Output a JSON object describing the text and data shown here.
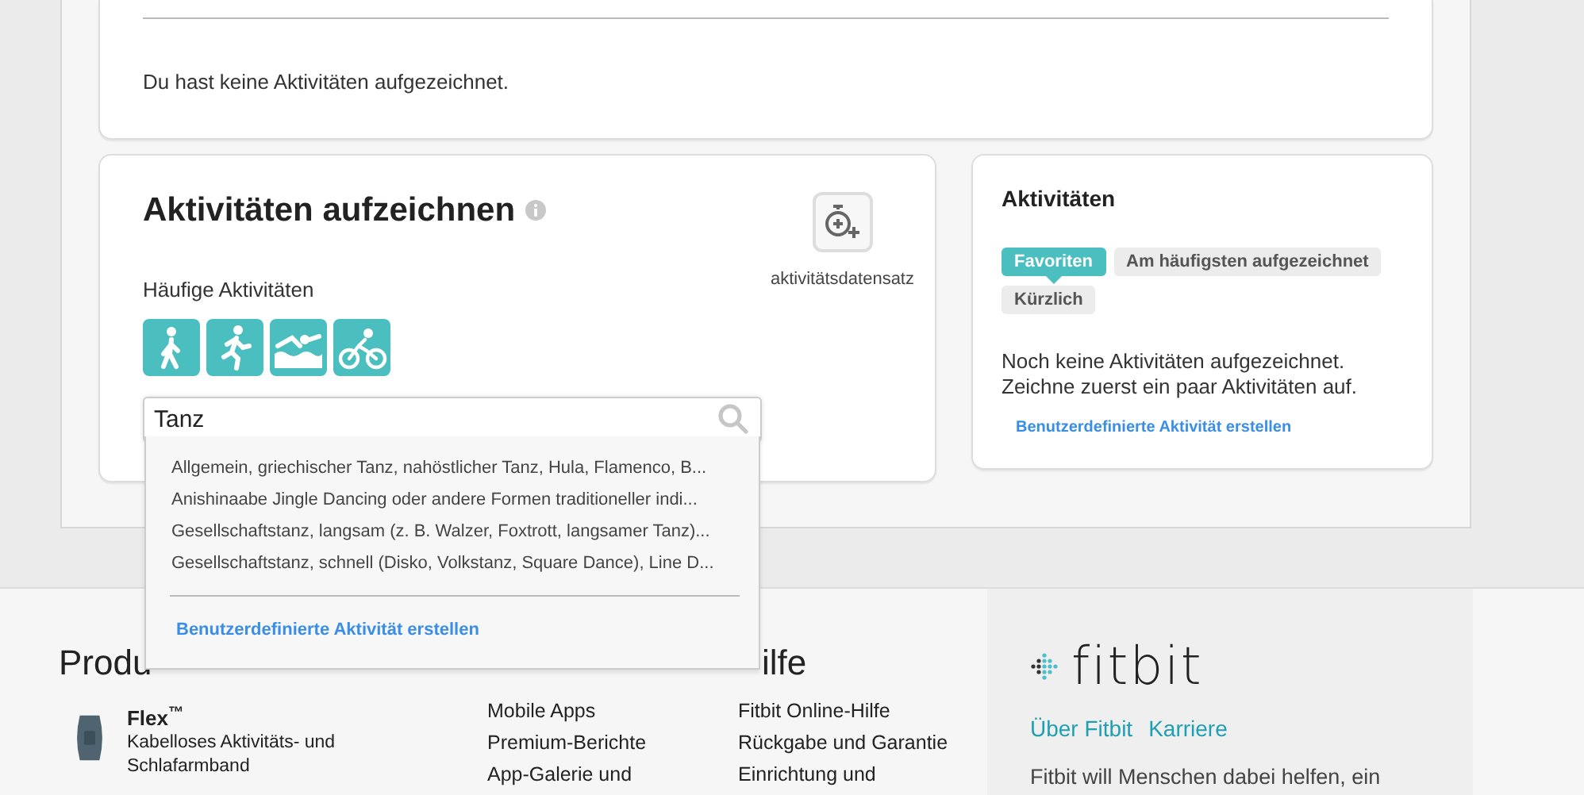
{
  "summary": {
    "message": "Du hast keine Aktivitäten aufgezeichnet."
  },
  "log_activity": {
    "title": "Aktivitäten aufzeichnen",
    "record_button": {
      "label": "aktivitätsdatensatz"
    },
    "frequent_label": "Häufige Aktivitäten",
    "frequent_activities": [
      {
        "kind": "walk"
      },
      {
        "kind": "run"
      },
      {
        "kind": "swim"
      },
      {
        "kind": "bike"
      }
    ],
    "search": {
      "value": "Tanz"
    },
    "suggestions": [
      "Allgemein, griechischer Tanz, nahöstlicher Tanz, Hula, Flamenco, B...",
      "Anishinaabe Jingle Dancing oder andere Formen traditioneller indi...",
      "Gesellschaftstanz, langsam (z. B. Walzer, Foxtrott, langsamer Tanz)...",
      "Gesellschaftstanz, schnell (Disko, Volkstanz, Square Dance), Line D..."
    ],
    "suggestion_link": "Benutzerdefinierte Aktivität erstellen"
  },
  "activities_panel": {
    "title": "Aktivitäten",
    "tabs": [
      {
        "label": "Favoriten",
        "selected": true
      },
      {
        "label": "Am häufigsten aufgezeichnet",
        "selected": false
      },
      {
        "label": "Kürzlich",
        "selected": false
      }
    ],
    "empty_message_lines": [
      "Noch keine Aktivitäten aufgezeichnet.",
      "Zeichne zuerst ein paar Aktivitäten auf."
    ],
    "link": "Benutzerdefinierte Aktivität erstellen"
  },
  "footer": {
    "columns": [
      {
        "heading": "Produ",
        "products": [
          {
            "name": "Flex$^{™}$",
            "description": "Kabelloses Aktivitäts- und Schlafarmband"
          }
        ]
      },
      {
        "links": [
          "Mobile Apps",
          "Premium-Berichte",
          "App-Galerie und"
        ]
      },
      {
        "heading": "ilfe",
        "links": [
          "Fitbit Online-Hilfe",
          "Rückgabe und Garantie",
          "Einrichtung und"
        ]
      }
    ],
    "brand": {
      "logo_text": "fitbit",
      "links": [
        "Über Fitbit",
        "Karriere"
      ],
      "tagline": "Fitbit will Menschen dabei helfen, ein"
    }
  }
}
